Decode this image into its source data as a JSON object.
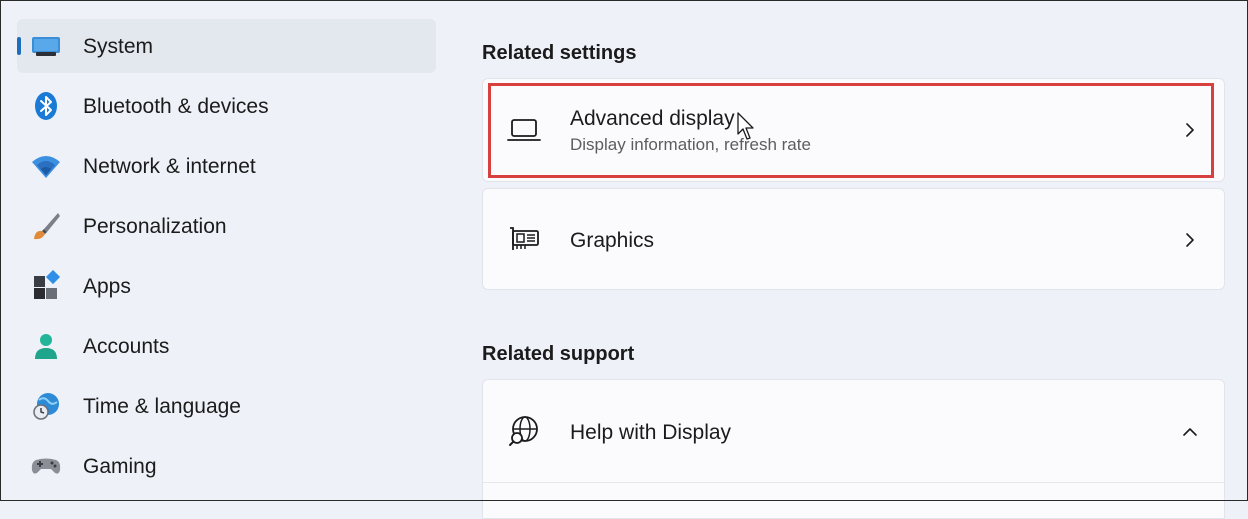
{
  "sidebar": {
    "items": [
      {
        "label": "System",
        "icon": "monitor-icon",
        "selected": true
      },
      {
        "label": "Bluetooth & devices",
        "icon": "bluetooth-icon"
      },
      {
        "label": "Network & internet",
        "icon": "wifi-icon"
      },
      {
        "label": "Personalization",
        "icon": "paintbrush-icon"
      },
      {
        "label": "Apps",
        "icon": "apps-icon"
      },
      {
        "label": "Accounts",
        "icon": "person-icon"
      },
      {
        "label": "Time & language",
        "icon": "globe-clock-icon"
      },
      {
        "label": "Gaming",
        "icon": "gamepad-icon"
      }
    ]
  },
  "main": {
    "related_settings": {
      "title": "Related settings",
      "cards": [
        {
          "title": "Advanced display",
          "subtitle": "Display information, refresh rate",
          "icon": "laptop-icon",
          "highlighted": true
        },
        {
          "title": "Graphics",
          "icon": "gpu-icon"
        }
      ]
    },
    "related_support": {
      "title": "Related support",
      "cards": [
        {
          "title": "Help with Display",
          "icon": "globe-search-icon",
          "expanded": true
        }
      ]
    }
  },
  "colors": {
    "accent": "#1f6dbd",
    "highlight_border": "#d8403f",
    "background": "#eef2f8",
    "card": "#fbfbfd"
  }
}
